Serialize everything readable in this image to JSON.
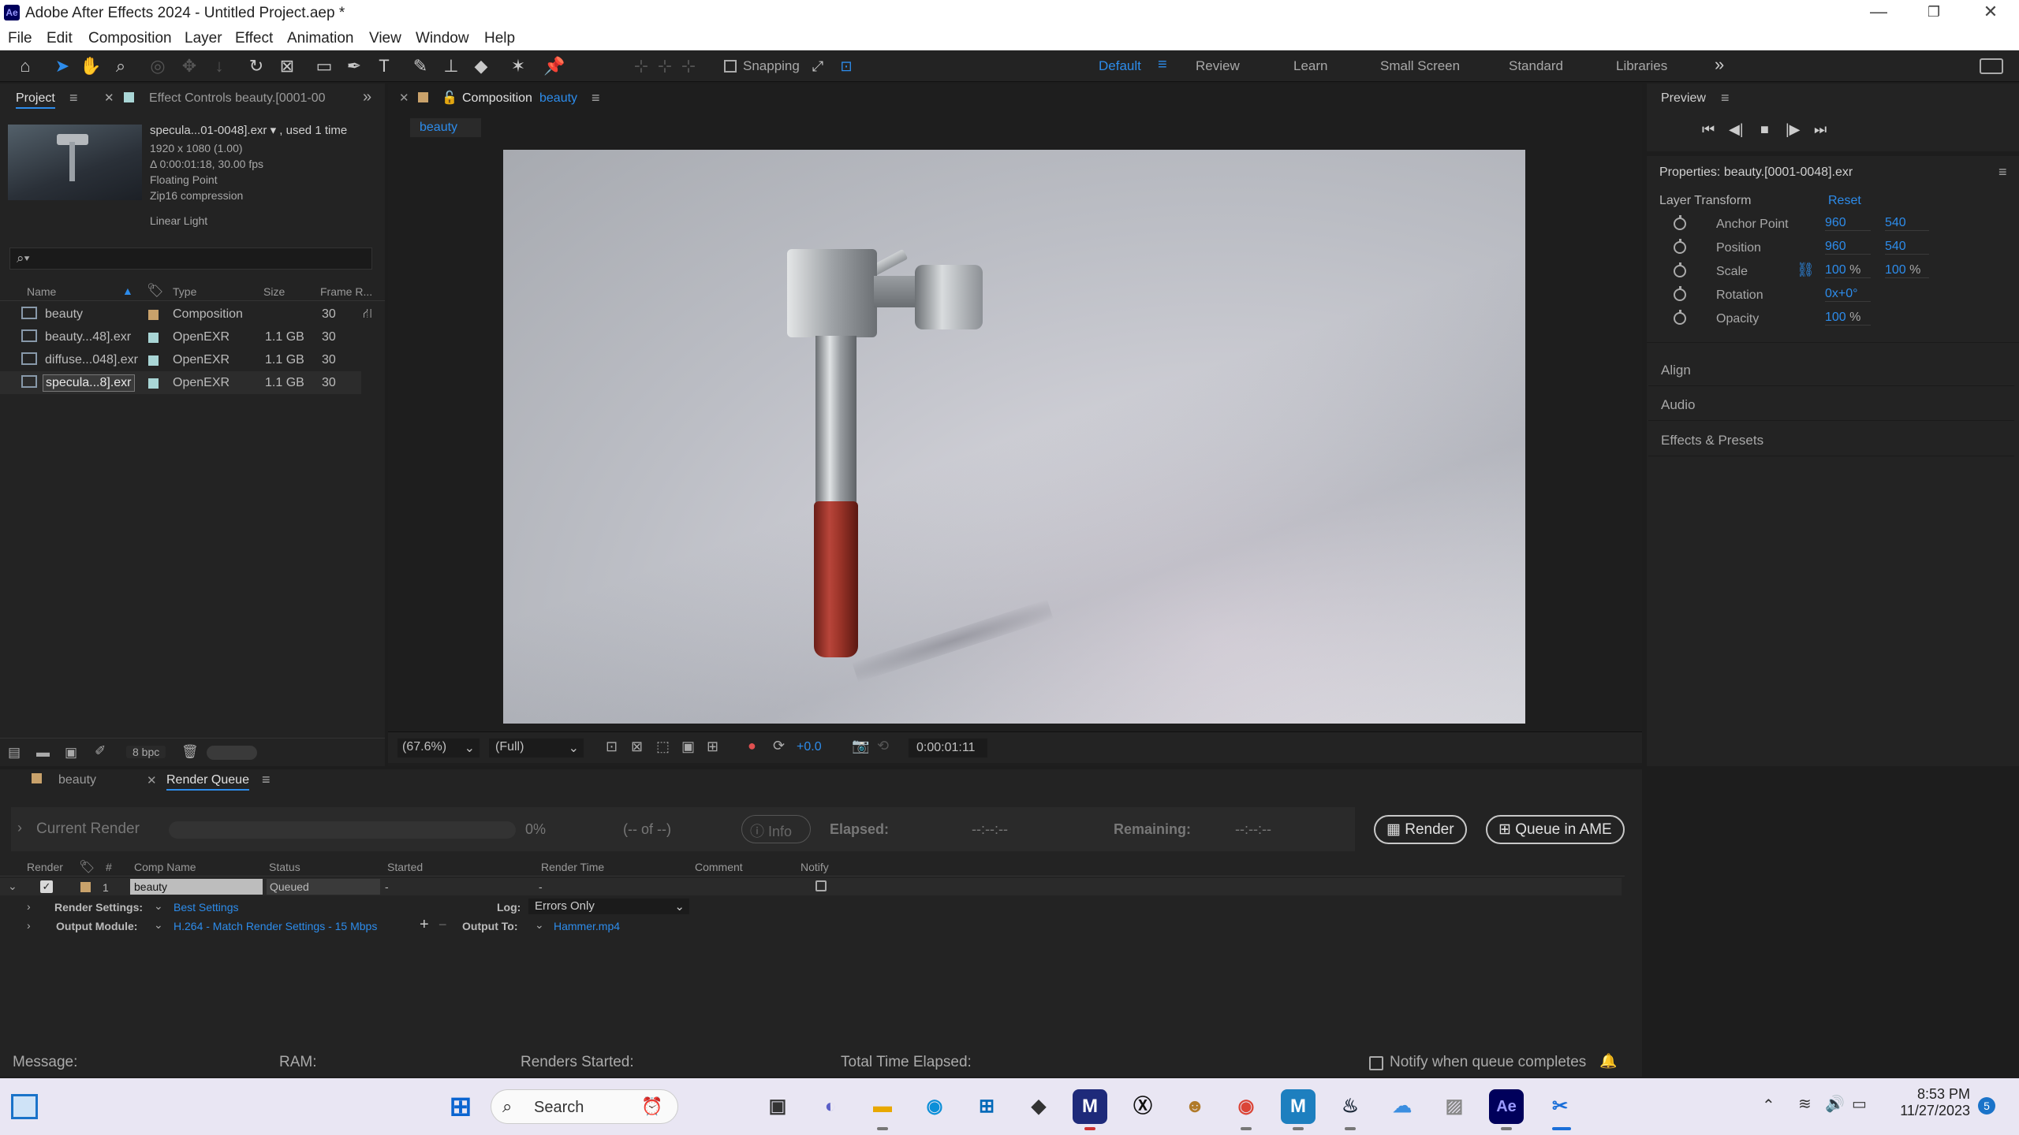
{
  "app": {
    "logo": "Ae",
    "title": "Adobe After Effects 2024 - Untitled Project.aep *"
  },
  "window_controls": {
    "minimize": "—",
    "maximize": "❐",
    "close": "✕"
  },
  "menu": [
    "File",
    "Edit",
    "Composition",
    "Layer",
    "Effect",
    "Animation",
    "View",
    "Window",
    "Help"
  ],
  "toolbar": {
    "snapping_label": "Snapping",
    "workspaces": [
      "Default",
      "Review",
      "Learn",
      "Small Screen",
      "Standard",
      "Libraries"
    ],
    "active_workspace": "Default",
    "more": "»"
  },
  "project_panel": {
    "tab_project": "Project",
    "tab_effect_controls": "Effect Controls beauty.[0001-00",
    "selected_name": "specula...01-0048].exr ▾ , used 1 time",
    "info_lines": [
      "1920 x 1080 (1.00)",
      "Δ 0:00:01:18, 30.00 fps",
      "Floating Point",
      "Zip16 compression"
    ],
    "color_space": "Linear Light",
    "search_placeholder": "",
    "columns": {
      "name": "Name",
      "type": "Type",
      "size": "Size",
      "frame_rate": "Frame R..."
    },
    "items": [
      {
        "name": "beauty",
        "type": "Composition",
        "size": "",
        "fps": "30",
        "swatch": "#c9a26b"
      },
      {
        "name": "beauty...48].exr",
        "type": "OpenEXR",
        "size": "1.1 GB",
        "fps": "30",
        "swatch": "#a9d6d6"
      },
      {
        "name": "diffuse...048].exr",
        "type": "OpenEXR",
        "size": "1.1 GB",
        "fps": "30",
        "swatch": "#a9d6d6"
      },
      {
        "name": "specula...8].exr",
        "type": "OpenEXR",
        "size": "1.1 GB",
        "fps": "30",
        "swatch": "#a9d6d6"
      }
    ],
    "bpc": "8 bpc"
  },
  "composition_panel": {
    "tab_label": "Composition",
    "tab_name": "beauty",
    "sub_tab": "beauty",
    "zoom": "(67.6%)",
    "resolution": "(Full)",
    "exposure": "+0.0",
    "timecode": "0:00:01:11"
  },
  "preview_panel": {
    "title": "Preview"
  },
  "properties_panel": {
    "title": "Properties: beauty.[0001-0048].exr",
    "section": "Layer Transform",
    "reset": "Reset",
    "props": [
      {
        "name": "Anchor Point",
        "v1": "960",
        "v2": "540"
      },
      {
        "name": "Position",
        "v1": "960",
        "v2": "540"
      },
      {
        "name": "Scale",
        "v1": "100",
        "v2": "100",
        "unit": "%"
      },
      {
        "name": "Rotation",
        "v1": "0",
        "v2": "x+0°"
      },
      {
        "name": "Opacity",
        "v1": "100",
        "unit": "%"
      }
    ],
    "sections": [
      "Align",
      "Audio",
      "Effects & Presets"
    ]
  },
  "render_queue": {
    "tab_beauty": "beauty",
    "tab_rq": "Render Queue",
    "current_render": "Current Render",
    "percent": "0%",
    "of": "(-- of --)",
    "info": "Info",
    "elapsed_label": "Elapsed:",
    "elapsed_val": "--:--:--",
    "remaining_label": "Remaining:",
    "remaining_val": "--:--:--",
    "render_btn": "Render",
    "queue_ame_btn": "Queue in AME",
    "columns": {
      "render": "Render",
      "num": "#",
      "comp": "Comp Name",
      "status": "Status",
      "started": "Started",
      "render_time": "Render Time",
      "comment": "Comment",
      "notify": "Notify"
    },
    "item": {
      "num": "1",
      "comp": "beauty",
      "status": "Queued",
      "started": "-",
      "render_time": "-"
    },
    "render_settings_label": "Render Settings:",
    "render_settings_val": "Best Settings",
    "log_label": "Log:",
    "log_val": "Errors Only",
    "output_module_label": "Output Module:",
    "output_module_val": "H.264 - Match Render Settings - 15 Mbps",
    "output_to_label": "Output To:",
    "output_to_val": "Hammer.mp4"
  },
  "status_bar": {
    "message": "Message:",
    "ram": "RAM:",
    "renders_started": "Renders Started:",
    "total_time": "Total Time Elapsed:",
    "notify": "Notify when queue completes"
  },
  "taskbar": {
    "search": "Search",
    "time": "8:53 PM",
    "date": "11/27/2023",
    "notif_count": "5"
  }
}
